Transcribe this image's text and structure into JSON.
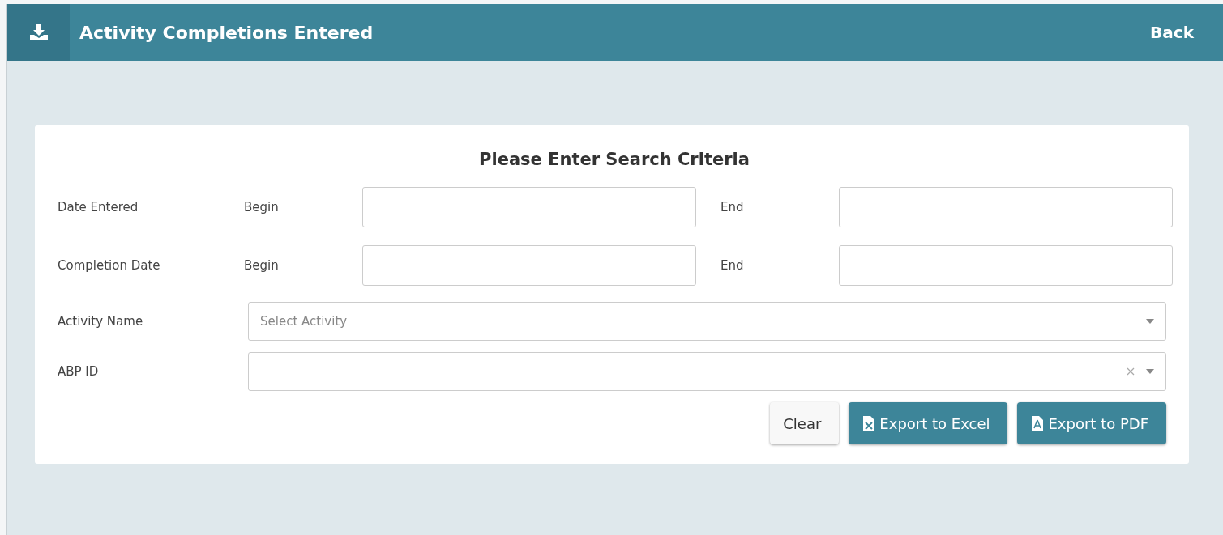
{
  "header": {
    "title": "Activity Completions Entered",
    "back": "Back"
  },
  "form": {
    "heading": "Please Enter Search Criteria",
    "date_rows": [
      {
        "label": "Date Entered",
        "begin_label": "Begin",
        "end_label": "End"
      },
      {
        "label": "Completion Date",
        "begin_label": "Begin",
        "end_label": "End"
      }
    ],
    "selects": [
      {
        "label": "Activity Name",
        "placeholder": "Select Activity",
        "clearable": false
      },
      {
        "label": "ABP ID",
        "clearable": true
      }
    ],
    "buttons": [
      {
        "label": "Clear",
        "kind": "plain"
      },
      {
        "label": "Export to Excel",
        "kind": "excel"
      },
      {
        "label": "Export to PDF",
        "kind": "pdf"
      }
    ]
  }
}
